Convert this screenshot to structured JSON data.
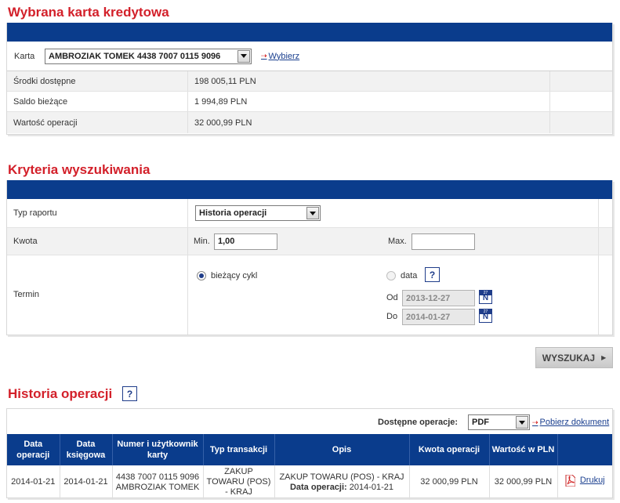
{
  "card_section": {
    "title": "Wybrana karta kredytowa",
    "card_label": "Karta",
    "card_value": "AMBROZIAK TOMEK 4438 7007 0115 9096",
    "choose_link": "Wybierz",
    "rows": [
      {
        "label": "Środki dostępne",
        "value": "198 005,11 PLN"
      },
      {
        "label": "Saldo bieżące",
        "value": "1 994,89 PLN"
      },
      {
        "label": "Wartość operacji",
        "value": "32 000,99 PLN"
      }
    ]
  },
  "criteria": {
    "title": "Kryteria wyszukiwania",
    "report_type_label": "Typ raportu",
    "report_type_value": "Historia operacji",
    "amount_label": "Kwota",
    "min_label": "Min.",
    "min_value": "1,00",
    "max_label": "Max.",
    "max_value": "",
    "term_label": "Termin",
    "current_cycle_label": "bieżący cykl",
    "date_label": "data",
    "help_glyph": "?",
    "from_label": "Od",
    "from_value": "2013-12-27",
    "to_label": "Do",
    "to_value": "2014-01-27",
    "calendar_day": "N",
    "calendar_top": "27",
    "search_button": "WYSZUKAJ"
  },
  "history": {
    "title": "Historia operacji",
    "help_glyph": "?",
    "available_ops_label": "Dostępne operacje:",
    "format_value": "PDF",
    "download_link": "Pobierz dokument",
    "columns": [
      "Data operacji",
      "Data księgowa",
      "Numer i użytkownik karty",
      "Typ transakcji",
      "Opis",
      "Kwota operacji",
      "Wartość w PLN",
      ""
    ],
    "rows": [
      {
        "op_date": "2014-01-21",
        "book_date": "2014-01-21",
        "card_number": "4438 7007 0115 9096",
        "card_user": "AMBROZIAK TOMEK",
        "type": "ZAKUP TOWARU (POS) - KRAJ",
        "desc": "ZAKUP TOWARU (POS) - KRAJ",
        "desc_date_label": "Data operacji:",
        "desc_date": "2014-01-21",
        "amount": "32 000,99 PLN",
        "value_pln": "32 000,99 PLN",
        "print_link": "Drukuj"
      }
    ]
  }
}
